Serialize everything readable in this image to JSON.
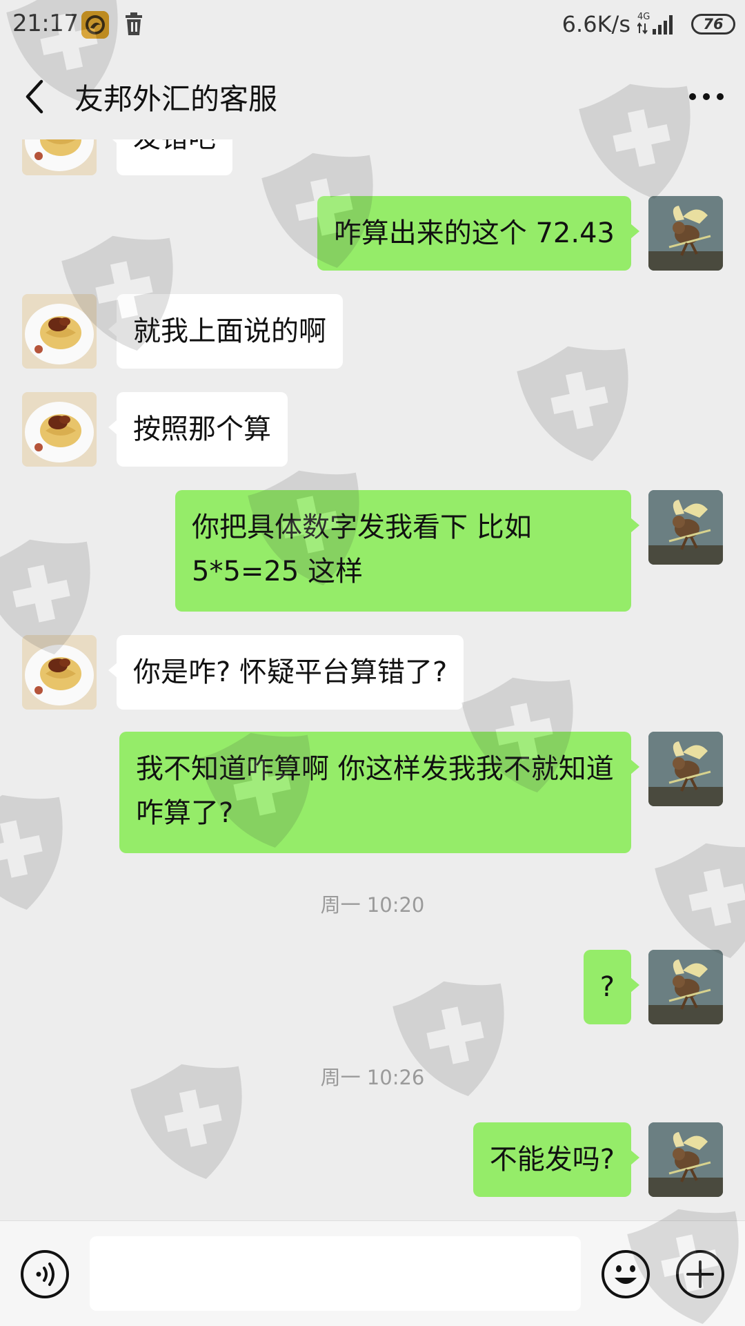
{
  "status_bar": {
    "time": "21:17",
    "network_speed": "6.6K/s",
    "network_type": "4G",
    "battery": "76",
    "app_icon": "lion-app-icon",
    "trash_icon": "trash-icon"
  },
  "header": {
    "title": "友邦外汇的客服",
    "back_icon": "chevron-left-icon",
    "more_icon": "more-dots-icon"
  },
  "messages": [
    {
      "side": "left",
      "text": "发错吧"
    },
    {
      "side": "right",
      "text": "咋算出来的这个 72.43"
    },
    {
      "side": "left",
      "text": "就我上面说的啊"
    },
    {
      "side": "left",
      "text": "按照那个算"
    },
    {
      "side": "right",
      "text": "你把具体数字发我看下 比如 5*5=25 这样"
    },
    {
      "side": "left",
      "text": "你是咋? 怀疑平台算错了?"
    },
    {
      "side": "right",
      "text": "我不知道咋算啊 你这样发我我不就知道咋算了?"
    },
    {
      "type": "time",
      "text": "周一 10:20"
    },
    {
      "side": "right",
      "text": "?"
    },
    {
      "type": "time",
      "text": "周一 10:26"
    },
    {
      "side": "right",
      "text": "不能发吗?"
    }
  ],
  "input_bar": {
    "voice_icon": "voice-icon",
    "input_value": "",
    "emoji_icon": "emoji-icon",
    "plus_icon": "plus-icon"
  },
  "colors": {
    "background": "#ededed",
    "bubble_self": "#95ec69",
    "bubble_other": "#ffffff",
    "timestamp": "#9a9a9a"
  }
}
